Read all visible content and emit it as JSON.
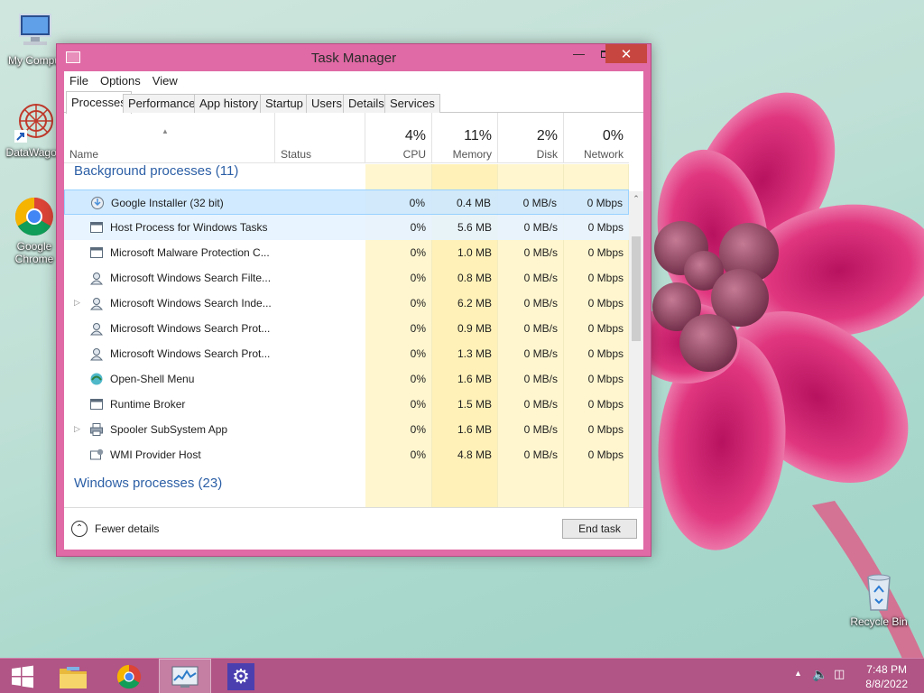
{
  "desktop": {
    "icons": [
      {
        "label": "My Compu",
        "icon": "computer-icon"
      },
      {
        "label": "DataWagon",
        "icon": "datawagon-shortcut-icon"
      },
      {
        "label": "Google Chrome",
        "icon": "chrome-icon"
      },
      {
        "label": "Recycle Bin",
        "icon": "recycle-bin-icon"
      }
    ]
  },
  "window": {
    "title": "Task Manager",
    "menu": [
      "File",
      "Options",
      "View"
    ],
    "tabs": [
      "Processes",
      "Performance",
      "App history",
      "Startup",
      "Users",
      "Details",
      "Services"
    ],
    "active_tab": "Processes",
    "columns": {
      "name": "Name",
      "status": "Status",
      "cpu": {
        "pct": "4%",
        "label": "CPU"
      },
      "memory": {
        "pct": "11%",
        "label": "Memory"
      },
      "disk": {
        "pct": "2%",
        "label": "Disk"
      },
      "network": {
        "pct": "0%",
        "label": "Network"
      }
    },
    "groups": {
      "background": "Background processes (11)",
      "windows": "Windows processes (23)"
    },
    "processes": [
      {
        "name": "Google Installer (32 bit)",
        "cpu": "0%",
        "mem": "0.4 MB",
        "disk": "0 MB/s",
        "net": "0 Mbps",
        "icon": "installer-icon",
        "expandable": false
      },
      {
        "name": "Host Process for Windows Tasks",
        "cpu": "0%",
        "mem": "5.6 MB",
        "disk": "0 MB/s",
        "net": "0 Mbps",
        "icon": "window-app-icon",
        "expandable": false
      },
      {
        "name": "Microsoft Malware Protection C...",
        "cpu": "0%",
        "mem": "1.0 MB",
        "disk": "0 MB/s",
        "net": "0 Mbps",
        "icon": "window-app-icon",
        "expandable": false
      },
      {
        "name": "Microsoft Windows Search Filte...",
        "cpu": "0%",
        "mem": "0.8 MB",
        "disk": "0 MB/s",
        "net": "0 Mbps",
        "icon": "search-user-icon",
        "expandable": false
      },
      {
        "name": "Microsoft Windows Search Inde...",
        "cpu": "0%",
        "mem": "6.2 MB",
        "disk": "0 MB/s",
        "net": "0 Mbps",
        "icon": "search-user-icon",
        "expandable": true
      },
      {
        "name": "Microsoft Windows Search Prot...",
        "cpu": "0%",
        "mem": "0.9 MB",
        "disk": "0 MB/s",
        "net": "0 Mbps",
        "icon": "search-user-icon",
        "expandable": false
      },
      {
        "name": "Microsoft Windows Search Prot...",
        "cpu": "0%",
        "mem": "1.3 MB",
        "disk": "0 MB/s",
        "net": "0 Mbps",
        "icon": "search-user-icon",
        "expandable": false
      },
      {
        "name": "Open-Shell Menu",
        "cpu": "0%",
        "mem": "1.6 MB",
        "disk": "0 MB/s",
        "net": "0 Mbps",
        "icon": "shell-icon",
        "expandable": false
      },
      {
        "name": "Runtime Broker",
        "cpu": "0%",
        "mem": "1.5 MB",
        "disk": "0 MB/s",
        "net": "0 Mbps",
        "icon": "window-app-icon",
        "expandable": false
      },
      {
        "name": "Spooler SubSystem App",
        "cpu": "0%",
        "mem": "1.6 MB",
        "disk": "0 MB/s",
        "net": "0 Mbps",
        "icon": "printer-icon",
        "expandable": true
      },
      {
        "name": "WMI Provider Host",
        "cpu": "0%",
        "mem": "4.8 MB",
        "disk": "0 MB/s",
        "net": "0 Mbps",
        "icon": "wmi-icon",
        "expandable": false
      }
    ],
    "footer": {
      "fewer_details": "Fewer details",
      "end_task": "End task"
    }
  },
  "taskbar": {
    "items": [
      "start-icon",
      "file-explorer-icon",
      "chrome-icon",
      "task-manager-icon",
      "settings-icon"
    ],
    "clock": {
      "time": "7:48 PM",
      "date": "8/8/2022"
    }
  },
  "colors": {
    "window_frame": "#e06aa5",
    "taskbar": "#b05585",
    "group_header": "#2c5fa6",
    "heat_cell": "#fff6cf",
    "close_button": "#c7463f"
  }
}
